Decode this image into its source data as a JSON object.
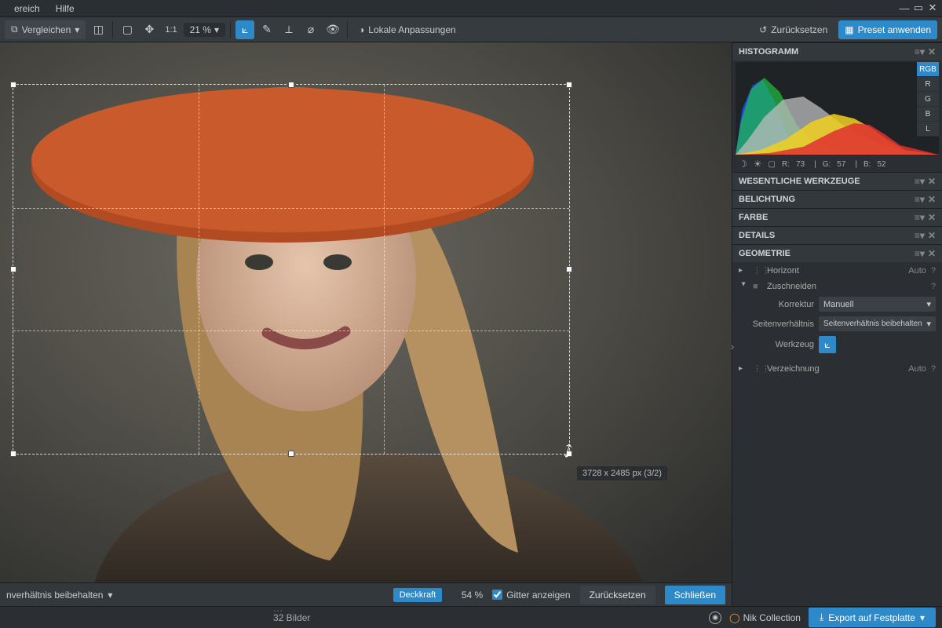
{
  "menubar": {
    "items": [
      "ereich",
      "Hilfe"
    ]
  },
  "toolbar": {
    "compare": "Vergleichen",
    "zoom": "21 %",
    "local_adjust": "Lokale Anpassungen",
    "reset": "Zurücksetzen",
    "apply_preset": "Preset anwenden",
    "one_to_one": "1:1"
  },
  "crop": {
    "dimensions": "3728 x 2485 px (3/2)"
  },
  "right": {
    "histogram": {
      "title": "HISTOGRAMM",
      "tabs": [
        "RGB",
        "R",
        "G",
        "B",
        "L"
      ],
      "readout": {
        "r_label": "R:",
        "r": "73",
        "g_label": "G:",
        "g": "57",
        "b_label": "B:",
        "b": "52"
      }
    },
    "sections": {
      "essential": "WESENTLICHE WERKZEUGE",
      "exposure": "BELICHTUNG",
      "color": "FARBE",
      "details": "DETAILS",
      "geometry": "GEOMETRIE"
    },
    "geometry": {
      "horizon": "Horizont",
      "auto": "Auto",
      "q": "?",
      "crop": "Zuschneiden",
      "correction_label": "Korrektur",
      "correction_value": "Manuell",
      "aspect_label": "Seitenverhältnis",
      "aspect_value": "Seitenverhältnis beibehalten",
      "tool_label": "Werkzeug",
      "distortion": "Verzeichnung"
    }
  },
  "cropbar": {
    "aspect_dropdown": "nverhältnis beibehalten",
    "opacity_label": "Deckkraft",
    "opacity_value": "54 %",
    "grid_checkbox": "Gitter anzeigen",
    "reset": "Zurücksetzen",
    "close": "Schließen"
  },
  "footer": {
    "count": "32 Bilder",
    "nik": "Nik Collection",
    "export": "Export auf Festplatte"
  }
}
